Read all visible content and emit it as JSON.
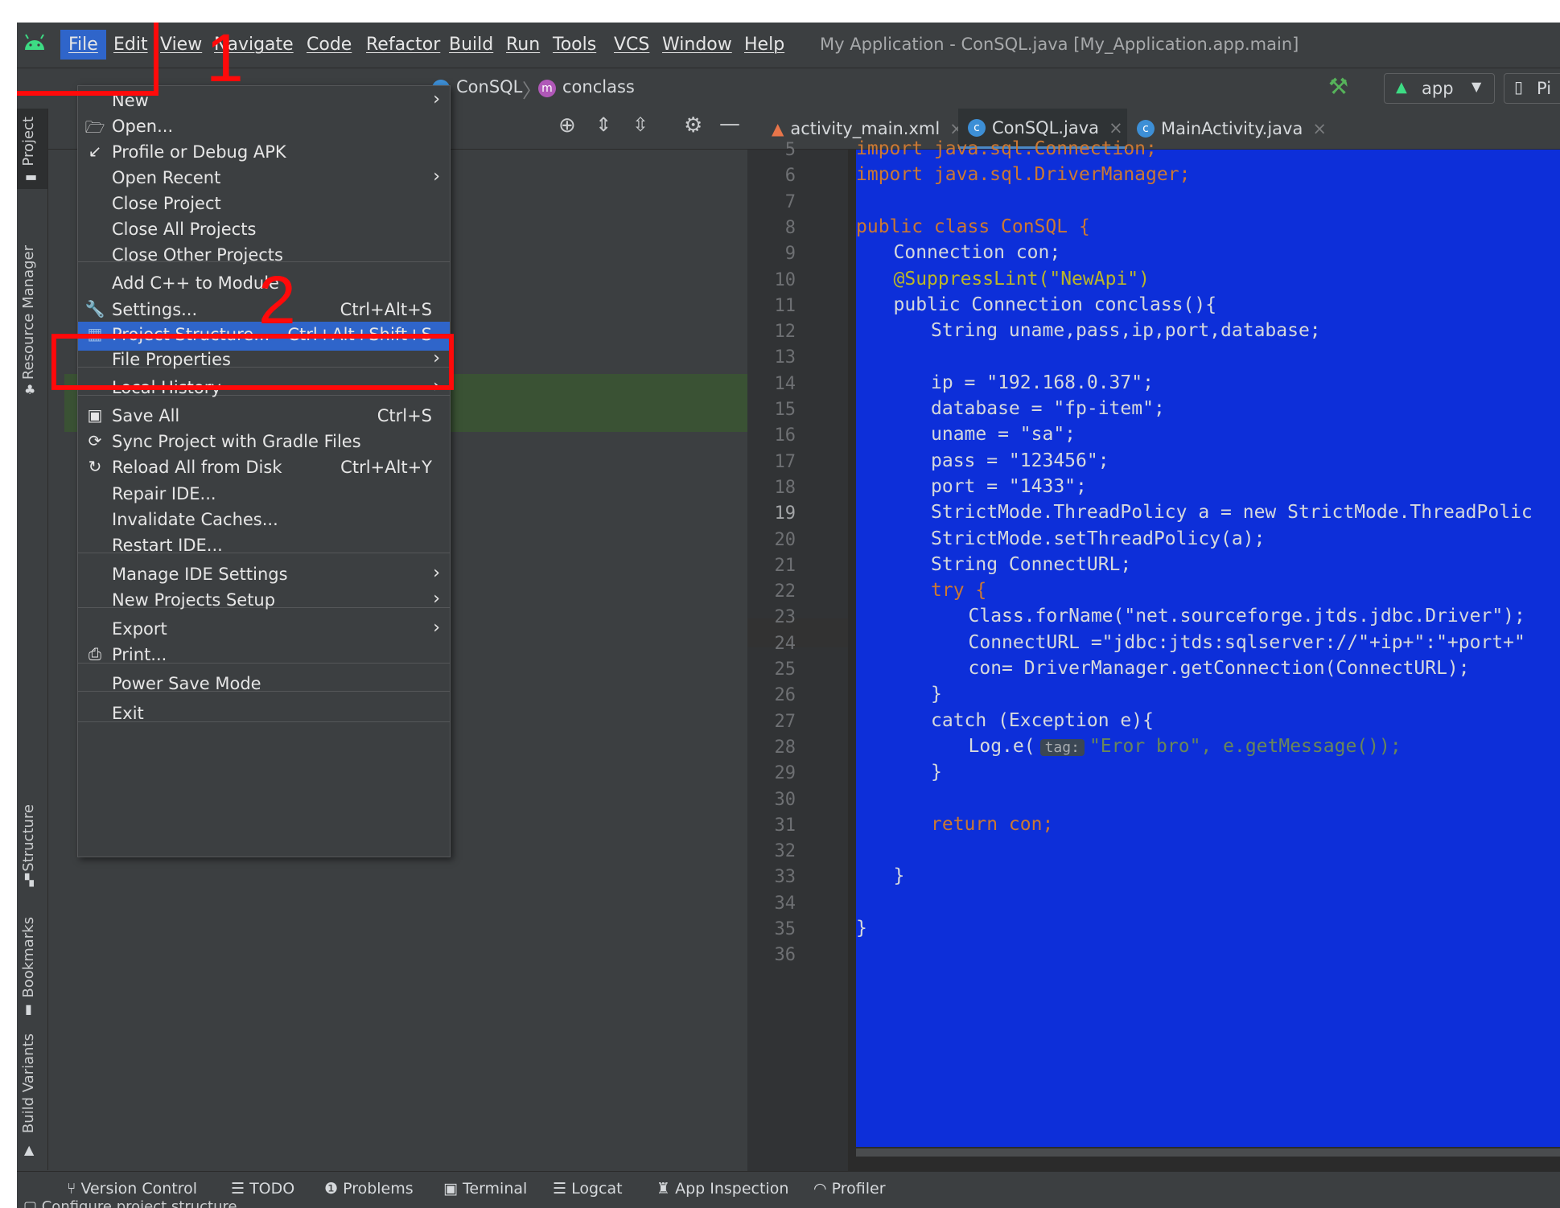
{
  "menubar": {
    "items": [
      "File",
      "Edit",
      "View",
      "Navigate",
      "Code",
      "Refactor",
      "Build",
      "Run",
      "Tools",
      "VCS",
      "Window",
      "Help"
    ],
    "window_title": "My Application - ConSQL.java [My_Application.app.main]"
  },
  "toolbar": {
    "breadcrumb_class": "ConSQL",
    "breadcrumb_method": "conclass",
    "run_config": "app",
    "device_partial": "Pi"
  },
  "left_stripe": {
    "tabs": [
      "Project",
      "Resource Manager",
      "Structure",
      "Bookmarks",
      "Build Variants"
    ]
  },
  "editor": {
    "tabs": [
      {
        "label": "activity_main.xml",
        "active": false
      },
      {
        "label": "ConSQL.java",
        "active": true
      },
      {
        "label": "MainActivity.java",
        "active": false
      }
    ],
    "line_numbers": [
      "5",
      "6",
      "7",
      "8",
      "9",
      "10",
      "11",
      "12",
      "13",
      "14",
      "15",
      "16",
      "17",
      "18",
      "19",
      "20",
      "21",
      "22",
      "23",
      "24",
      "25",
      "26",
      "27",
      "28",
      "29",
      "30",
      "31",
      "32",
      "33",
      "34",
      "35",
      "36"
    ],
    "current_line": "19",
    "code": {
      "l5": "import java.sql.Connection;",
      "l6": "import java.sql.DriverManager;",
      "l8": "public class ConSQL {",
      "l9": "Connection con;",
      "l10": "@SuppressLint(\"NewApi\")",
      "l11": "public Connection conclass(){",
      "l12": "String uname,pass,ip,port,database;",
      "l14": "ip = \"192.168.0.37\";",
      "l15": "database = \"fp-item\";",
      "l16": "uname = \"sa\";",
      "l17": "pass = \"123456\";",
      "l18": "port = \"1433\";",
      "l19": "StrictMode.ThreadPolicy a = new StrictMode.ThreadPolic",
      "l20": "StrictMode.setThreadPolicy(a);",
      "l21": "String ConnectURL;",
      "l22": "try {",
      "l23": "Class.forName(\"net.sourceforge.jtds.jdbc.Driver\");",
      "l24": "ConnectURL =\"jdbc:jtds:sqlserver://\"+ip+\":\"+port+\"",
      "l25": "con= DriverManager.getConnection(ConnectURL);",
      "l26": "}",
      "l27": "catch (Exception e){",
      "l28_pre": "Log.e(",
      "l28_hint": "tag:",
      "l28_post": "\"Eror bro\", e.getMessage());",
      "l29": "}",
      "l31": "return con;",
      "l33": "}",
      "l35": "}"
    }
  },
  "file_menu": {
    "items": [
      {
        "label": "New",
        "shortcut": "",
        "submenu": true,
        "icon": ""
      },
      {
        "label": "Open...",
        "shortcut": "",
        "submenu": false,
        "icon": "folder-icon"
      },
      {
        "label": "Profile or Debug APK",
        "shortcut": "",
        "submenu": false,
        "icon": "profile-apk-icon"
      },
      {
        "label": "Open Recent",
        "shortcut": "",
        "submenu": true,
        "icon": ""
      },
      {
        "label": "Close Project",
        "shortcut": "",
        "submenu": false,
        "icon": ""
      },
      {
        "label": "Close All Projects",
        "shortcut": "",
        "submenu": false,
        "icon": ""
      },
      {
        "label": "Close Other Projects",
        "shortcut": "",
        "submenu": false,
        "icon": ""
      },
      {
        "label": "Add C++ to Module",
        "shortcut": "",
        "submenu": false,
        "icon": ""
      },
      {
        "label": "Settings...",
        "shortcut": "Ctrl+Alt+S",
        "submenu": false,
        "icon": "wrench-icon"
      },
      {
        "label": "Project Structure...",
        "shortcut": "Ctrl+Alt+Shift+S",
        "submenu": false,
        "icon": "project-structure-icon"
      },
      {
        "label": "File Properties",
        "shortcut": "",
        "submenu": true,
        "icon": ""
      },
      {
        "label": "Local History",
        "shortcut": "",
        "submenu": true,
        "icon": ""
      },
      {
        "label": "Save All",
        "shortcut": "Ctrl+S",
        "submenu": false,
        "icon": "save-icon"
      },
      {
        "label": "Sync Project with Gradle Files",
        "shortcut": "",
        "submenu": false,
        "icon": "gradle-sync-icon"
      },
      {
        "label": "Reload All from Disk",
        "shortcut": "Ctrl+Alt+Y",
        "submenu": false,
        "icon": "reload-icon"
      },
      {
        "label": "Repair IDE...",
        "shortcut": "",
        "submenu": false,
        "icon": ""
      },
      {
        "label": "Invalidate Caches...",
        "shortcut": "",
        "submenu": false,
        "icon": ""
      },
      {
        "label": "Restart IDE...",
        "shortcut": "",
        "submenu": false,
        "icon": ""
      },
      {
        "label": "Manage IDE Settings",
        "shortcut": "",
        "submenu": true,
        "icon": ""
      },
      {
        "label": "New Projects Setup",
        "shortcut": "",
        "submenu": true,
        "icon": ""
      },
      {
        "label": "Export",
        "shortcut": "",
        "submenu": true,
        "icon": ""
      },
      {
        "label": "Print...",
        "shortcut": "",
        "submenu": false,
        "icon": "print-icon"
      },
      {
        "label": "Power Save Mode",
        "shortcut": "",
        "submenu": false,
        "icon": ""
      },
      {
        "label": "Exit",
        "shortcut": "",
        "submenu": false,
        "icon": ""
      }
    ],
    "highlighted": "Project Structure..."
  },
  "annotations": {
    "step1": "1",
    "step2": "2",
    "color": "#ff0a0a"
  },
  "bottom_tools": [
    "Version Control",
    "TODO",
    "Problems",
    "Terminal",
    "Logcat",
    "App Inspection",
    "Profiler"
  ],
  "status": {
    "text": "Configure project structure"
  },
  "colors": {
    "selection": "#0d2fd9",
    "menu_highlight": "#2f65ca",
    "keyword": "#cc7832",
    "string": "#6a8759"
  }
}
